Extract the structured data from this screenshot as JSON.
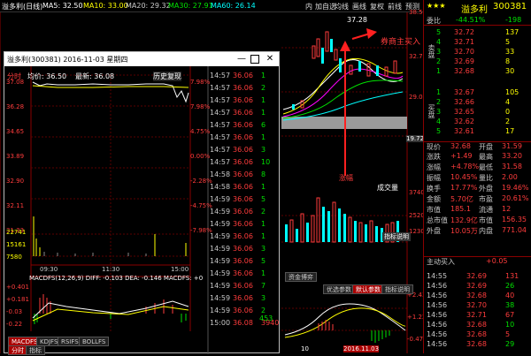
{
  "topbar": {
    "stock_label": "溢多利(日线)",
    "ma5": "MA5: 32.50",
    "ma10": "MA10: 33.00",
    "ma20": "MA20: 29.32",
    "ma30": "MA30: 27.91",
    "ma60": "MA60: 26.14",
    "menu": [
      "内",
      "加自选",
      "均线",
      "画线",
      "复权",
      "前线",
      "预测"
    ]
  },
  "main_chart": {
    "high_label": "37.28",
    "price_ticks": [
      "38.53",
      "32.72",
      "29.08"
    ],
    "low_label": "19.72",
    "annotation": "券商主买入",
    "arrow_label": "涨幅",
    "vol_label": "成交量",
    "vol_ticks": [
      "3740",
      "2520",
      "1230"
    ],
    "indicator_button": "指标说明",
    "tabs": [
      "资金博弈",
      "优选参数",
      "默认参数",
      "指标说明"
    ],
    "ind_ticks": [
      "+2.43",
      "+1.22",
      "-0.47"
    ],
    "date_label": "2016.11.03",
    "x_label": "10"
  },
  "right_panel": {
    "stars": "★★★",
    "name": "溢多利",
    "code": "300381",
    "weibi_label": "委比",
    "weibi_value": "-44.51%",
    "weibi_diff": "-198",
    "sell_label": "卖盘",
    "buy_label": "买盘",
    "sell_orders": [
      {
        "price": "32.72",
        "vol": "137"
      },
      {
        "price": "32.71",
        "vol": "5"
      },
      {
        "price": "32.70",
        "vol": "33"
      },
      {
        "price": "32.69",
        "vol": "8"
      },
      {
        "price": "32.68",
        "vol": "30"
      }
    ],
    "buy_orders": [
      {
        "price": "32.67",
        "vol": "105"
      },
      {
        "price": "32.66",
        "vol": "4"
      },
      {
        "price": "32.65",
        "vol": "0"
      },
      {
        "price": "32.62",
        "vol": "2"
      },
      {
        "price": "32.61",
        "vol": "17"
      }
    ],
    "stats": [
      {
        "l1": "现价",
        "v1": "32.68",
        "l2": "开盘",
        "v2": "31.59"
      },
      {
        "l1": "涨跌",
        "v1": "+1.49",
        "l2": "最高",
        "v2": "33.20"
      },
      {
        "l1": "涨幅",
        "v1": "+4.78%",
        "l2": "最低",
        "v2": "31.58"
      },
      {
        "l1": "振幅",
        "v1": "10.45%",
        "l2": "量比",
        "v2": "2.00"
      },
      {
        "l1": "换手",
        "v1": "17.77%",
        "l2": "外盘",
        "v2": "19.46%"
      },
      {
        "l1": "金额",
        "v1": "5.70亿",
        "l2": "市盈",
        "v2": "20.61%"
      },
      {
        "l1": "市值",
        "v1": "185.1",
        "l2": "流通",
        "v2": "12"
      },
      {
        "l1": "总市值",
        "v1": "132.9亿",
        "l2": "市值",
        "v2": "156.35"
      },
      {
        "l1": "外盘",
        "v1": "10.05万",
        "l2": "内盘",
        "v2": "771.04"
      }
    ],
    "flow_label": "主动买入",
    "flow_value": "+0.05",
    "ticks": [
      {
        "time": "14:55",
        "price": "32.69",
        "vol": "131"
      },
      {
        "time": "14:56",
        "price": "32.69",
        "vol": "26"
      },
      {
        "time": "14:56",
        "price": "32.68",
        "vol": "40"
      },
      {
        "time": "14:56",
        "price": "32.70",
        "vol": "38"
      },
      {
        "time": "14:56",
        "price": "32.71",
        "vol": "67"
      },
      {
        "time": "14:56",
        "price": "32.68",
        "vol": "10"
      },
      {
        "time": "14:56",
        "price": "32.68",
        "vol": "5"
      },
      {
        "time": "14:56",
        "price": "32.68",
        "vol": "29"
      }
    ]
  },
  "popup": {
    "title": "溢多利(300381) 2016-11-03 星期四",
    "header_left": "分时",
    "avg_label": "均价: 36.50",
    "last_label": "最新: 36.08",
    "history_label": "历史复现",
    "left_ticks": [
      "37.08",
      "36.28",
      "34.65",
      "33.89",
      "32.90",
      "32.11",
      "31.33"
    ],
    "right_ticks": [
      "7.98%",
      "7.98%",
      "4.75%",
      "0.00%",
      "-2.28%",
      "-4.75%",
      "-7.98%"
    ],
    "vol_ticks": [
      "22741",
      "15161",
      "7580"
    ],
    "time_labels": [
      "09:30",
      "11:30",
      "15:00"
    ],
    "macd_label": "MACDFS(12,26,9) DIFF: -0.103 DEA: -0.146 MACDFS: +0",
    "macd_ticks": [
      "+0.401",
      "+0.181",
      "-0.03",
      "-0.22"
    ],
    "tabs": [
      "MACDFS",
      "KDJFS",
      "RSIFS",
      "BOLLFS"
    ],
    "bottom_tabs": [
      "分时",
      "指标"
    ],
    "ticks": [
      {
        "t": "14:57",
        "p": "36.06",
        "v": "1"
      },
      {
        "t": "14:57",
        "p": "36.06",
        "v": "2"
      },
      {
        "t": "14:57",
        "p": "36.06",
        "v": "1"
      },
      {
        "t": "14:57",
        "p": "36.06",
        "v": "1"
      },
      {
        "t": "14:57",
        "p": "36.06",
        "v": "6"
      },
      {
        "t": "14:57",
        "p": "36.06",
        "v": "1"
      },
      {
        "t": "14:57",
        "p": "36.06",
        "v": "3"
      },
      {
        "t": "14:57",
        "p": "36.06",
        "v": "10"
      },
      {
        "t": "14:58",
        "p": "36.06",
        "v": "8"
      },
      {
        "t": "14:58",
        "p": "36.06",
        "v": "1"
      },
      {
        "t": "14:59",
        "p": "36.06",
        "v": "5"
      },
      {
        "t": "14:59",
        "p": "36.06",
        "v": "2"
      },
      {
        "t": "14:59",
        "p": "36.06",
        "v": "1"
      },
      {
        "t": "14:59",
        "p": "36.06",
        "v": "1"
      },
      {
        "t": "14:59",
        "p": "36.06",
        "v": "3"
      },
      {
        "t": "14:59",
        "p": "36.06",
        "v": "5"
      },
      {
        "t": "14:59",
        "p": "36.06",
        "v": "1"
      },
      {
        "t": "14:59",
        "p": "36.06",
        "v": "7"
      },
      {
        "t": "14:59",
        "p": "36.06",
        "v": "3"
      },
      {
        "t": "14:59",
        "p": "36.06",
        "v": "2"
      },
      {
        "t": "15:00",
        "p": "36.08",
        "v": "3940"
      }
    ],
    "last_tick_extra": "453"
  },
  "colors": {
    "accent": "#ff3c3c",
    "down": "#00e000",
    "border": "#8a0000"
  }
}
